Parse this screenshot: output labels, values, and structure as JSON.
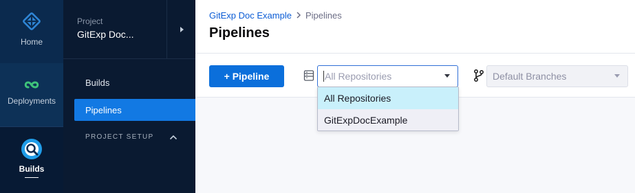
{
  "nav_rail": {
    "items": [
      {
        "label": "Home",
        "icon": "home-icon"
      },
      {
        "label": "Deployments",
        "icon": "deployments-icon"
      },
      {
        "label": "Builds",
        "icon": "builds-icon"
      }
    ]
  },
  "project": {
    "kicker": "Project",
    "name": "GitExp Doc..."
  },
  "sidebar": {
    "items": [
      {
        "label": "Builds"
      },
      {
        "label": "Pipelines"
      }
    ],
    "section": "PROJECT SETUP"
  },
  "breadcrumb": {
    "link": "GitExp Doc Example",
    "current": "Pipelines"
  },
  "page": {
    "title": "Pipelines"
  },
  "toolbar": {
    "add_label": "+ Pipeline",
    "repo_placeholder": "All Repositories",
    "branch_placeholder": "Default Branches"
  },
  "repo_dropdown": {
    "options": [
      {
        "label": "All Repositories"
      },
      {
        "label": "GitExpDocExample"
      }
    ]
  },
  "colors": {
    "rail_bg": "#0b2a4e",
    "sidebar_bg": "#0a1a31",
    "accent": "#1279e3",
    "button": "#0b6fdb",
    "link": "#0b5cd5",
    "selected_option": "#c9f0fb"
  }
}
